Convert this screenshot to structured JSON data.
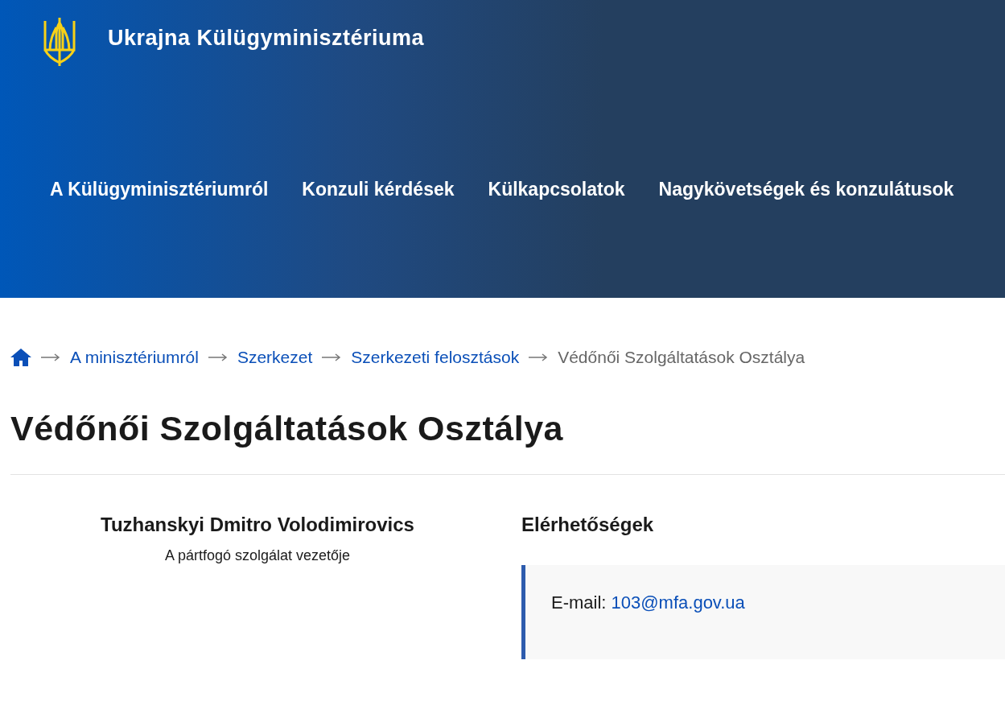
{
  "header": {
    "title": "Ukrajna Külügyminisztériuma",
    "nav": [
      {
        "label": "A Külügyminisztériumról"
      },
      {
        "label": "Konzuli kérdések"
      },
      {
        "label": "Külkapcsolatok"
      },
      {
        "label": "Nagykövetségek és konzulátusok"
      }
    ]
  },
  "breadcrumb": [
    {
      "label": "A minisztériumról",
      "kind": "link"
    },
    {
      "label": "Szerkezet",
      "kind": "link"
    },
    {
      "label": "Szerkezeti felosztások",
      "kind": "link"
    },
    {
      "label": "Védőnői Szolgáltatások Osztálya",
      "kind": "current"
    }
  ],
  "page_title": "Védőnői Szolgáltatások Osztálya",
  "person": {
    "name": "Tuzhanskyi Dmitro Volodimirovics",
    "role": "A pártfogó szolgálat vezetője"
  },
  "contacts": {
    "heading": "Elérhetőségek",
    "email_label": "E-mail:",
    "email": "103@mfa.gov.ua"
  }
}
